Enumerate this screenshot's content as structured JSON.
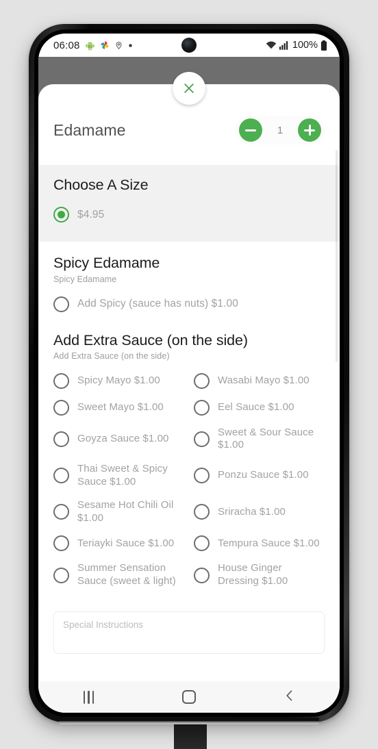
{
  "status_bar": {
    "time": "06:08",
    "icons_left": [
      "android-robot-icon",
      "photos-pinwheel-icon",
      "location-pin-icon",
      "dot-icon"
    ],
    "battery_percent": "100%",
    "icons_right": [
      "wifi-icon",
      "cellular-signal-icon",
      "battery-icon"
    ]
  },
  "modal": {
    "close_icon": "close-icon",
    "product": {
      "name": "Edamame",
      "quantity": "1",
      "decrease_icon": "minus-icon",
      "increase_icon": "plus-icon"
    },
    "sections": [
      {
        "title": "Choose A Size",
        "subtitle": "",
        "shaded": true,
        "layout": "single",
        "options": [
          {
            "label": "$4.95",
            "selected": true
          }
        ]
      },
      {
        "title": "Spicy Edamame",
        "subtitle": "Spicy Edamame",
        "shaded": false,
        "layout": "single",
        "options": [
          {
            "label": "Add Spicy (sauce has nuts) $1.00",
            "selected": false
          }
        ]
      },
      {
        "title": "Add Extra Sauce (on the side)",
        "subtitle": "Add Extra Sauce (on the side)",
        "shaded": false,
        "layout": "grid2",
        "options": [
          {
            "label": "Spicy Mayo $1.00",
            "selected": false
          },
          {
            "label": "Wasabi Mayo $1.00",
            "selected": false
          },
          {
            "label": "Sweet Mayo $1.00",
            "selected": false
          },
          {
            "label": "Eel Sauce $1.00",
            "selected": false
          },
          {
            "label": "Goyza Sauce $1.00",
            "selected": false
          },
          {
            "label": "Sweet & Sour Sauce $1.00",
            "selected": false
          },
          {
            "label": "Thai Sweet & Spicy Sauce $1.00",
            "selected": false
          },
          {
            "label": "Ponzu Sauce $1.00",
            "selected": false
          },
          {
            "label": "Sesame Hot Chili Oil $1.00",
            "selected": false
          },
          {
            "label": "Sriracha $1.00",
            "selected": false
          },
          {
            "label": "Teriayki Sauce $1.00",
            "selected": false
          },
          {
            "label": "Tempura Sauce $1.00",
            "selected": false
          },
          {
            "label": "Summer Sensation Sauce (sweet & light)",
            "selected": false
          },
          {
            "label": "House Ginger Dressing $1.00",
            "selected": false
          }
        ]
      }
    ],
    "special_instructions": {
      "placeholder": "Special Instructions",
      "value": ""
    }
  },
  "nav_bar": {
    "recents_label": "recents-icon",
    "home_label": "home-icon",
    "back_label": "back-icon"
  },
  "colors": {
    "accent_green": "#4caf50",
    "radio_green": "#3faa46",
    "scrim": "#6e6e6e",
    "shaded_section": "#f1f1f1"
  }
}
